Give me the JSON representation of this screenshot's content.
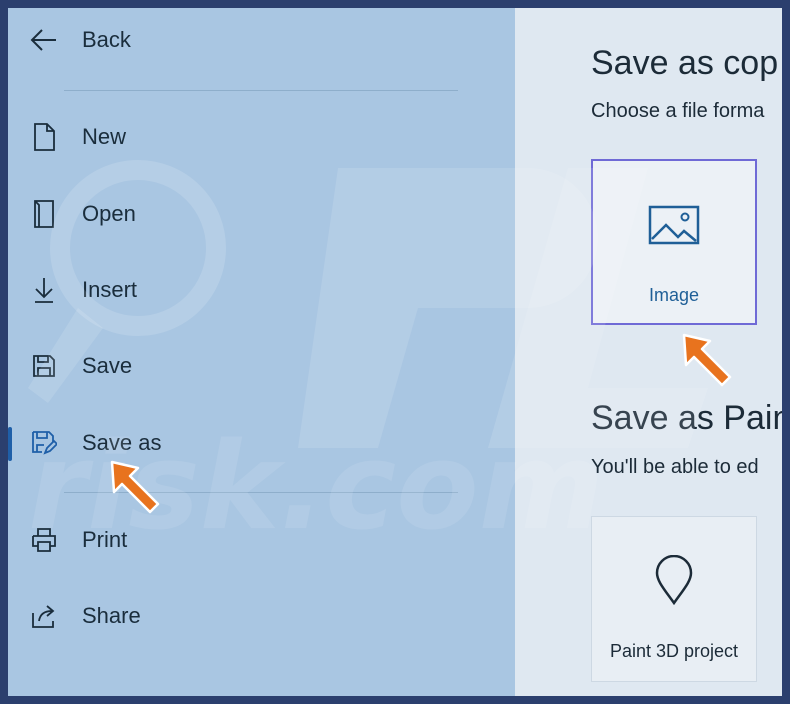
{
  "nav": {
    "back": "Back",
    "items": [
      {
        "label": "New",
        "icon": "new-file-icon"
      },
      {
        "label": "Open",
        "icon": "open-folder-icon"
      },
      {
        "label": "Insert",
        "icon": "insert-icon"
      },
      {
        "label": "Save",
        "icon": "save-icon"
      },
      {
        "label": "Save as",
        "icon": "save-as-icon",
        "active": true
      },
      {
        "label": "Print",
        "icon": "print-icon"
      },
      {
        "label": "Share",
        "icon": "share-icon"
      }
    ]
  },
  "content": {
    "copy_section": {
      "title": "Save as cop",
      "subtitle": "Choose a file forma",
      "tile_label": "Image"
    },
    "paint_section": {
      "title": "Save as Pain",
      "subtitle": "You'll be able to ed",
      "tile_label": "Paint 3D project"
    }
  },
  "colors": {
    "nav_bg": "#a9c6e2",
    "content_bg": "#dfe8f1",
    "accent": "#1f5fa8",
    "selected_border": "#6f6ad6",
    "annotation_arrow": "#e8731e"
  }
}
